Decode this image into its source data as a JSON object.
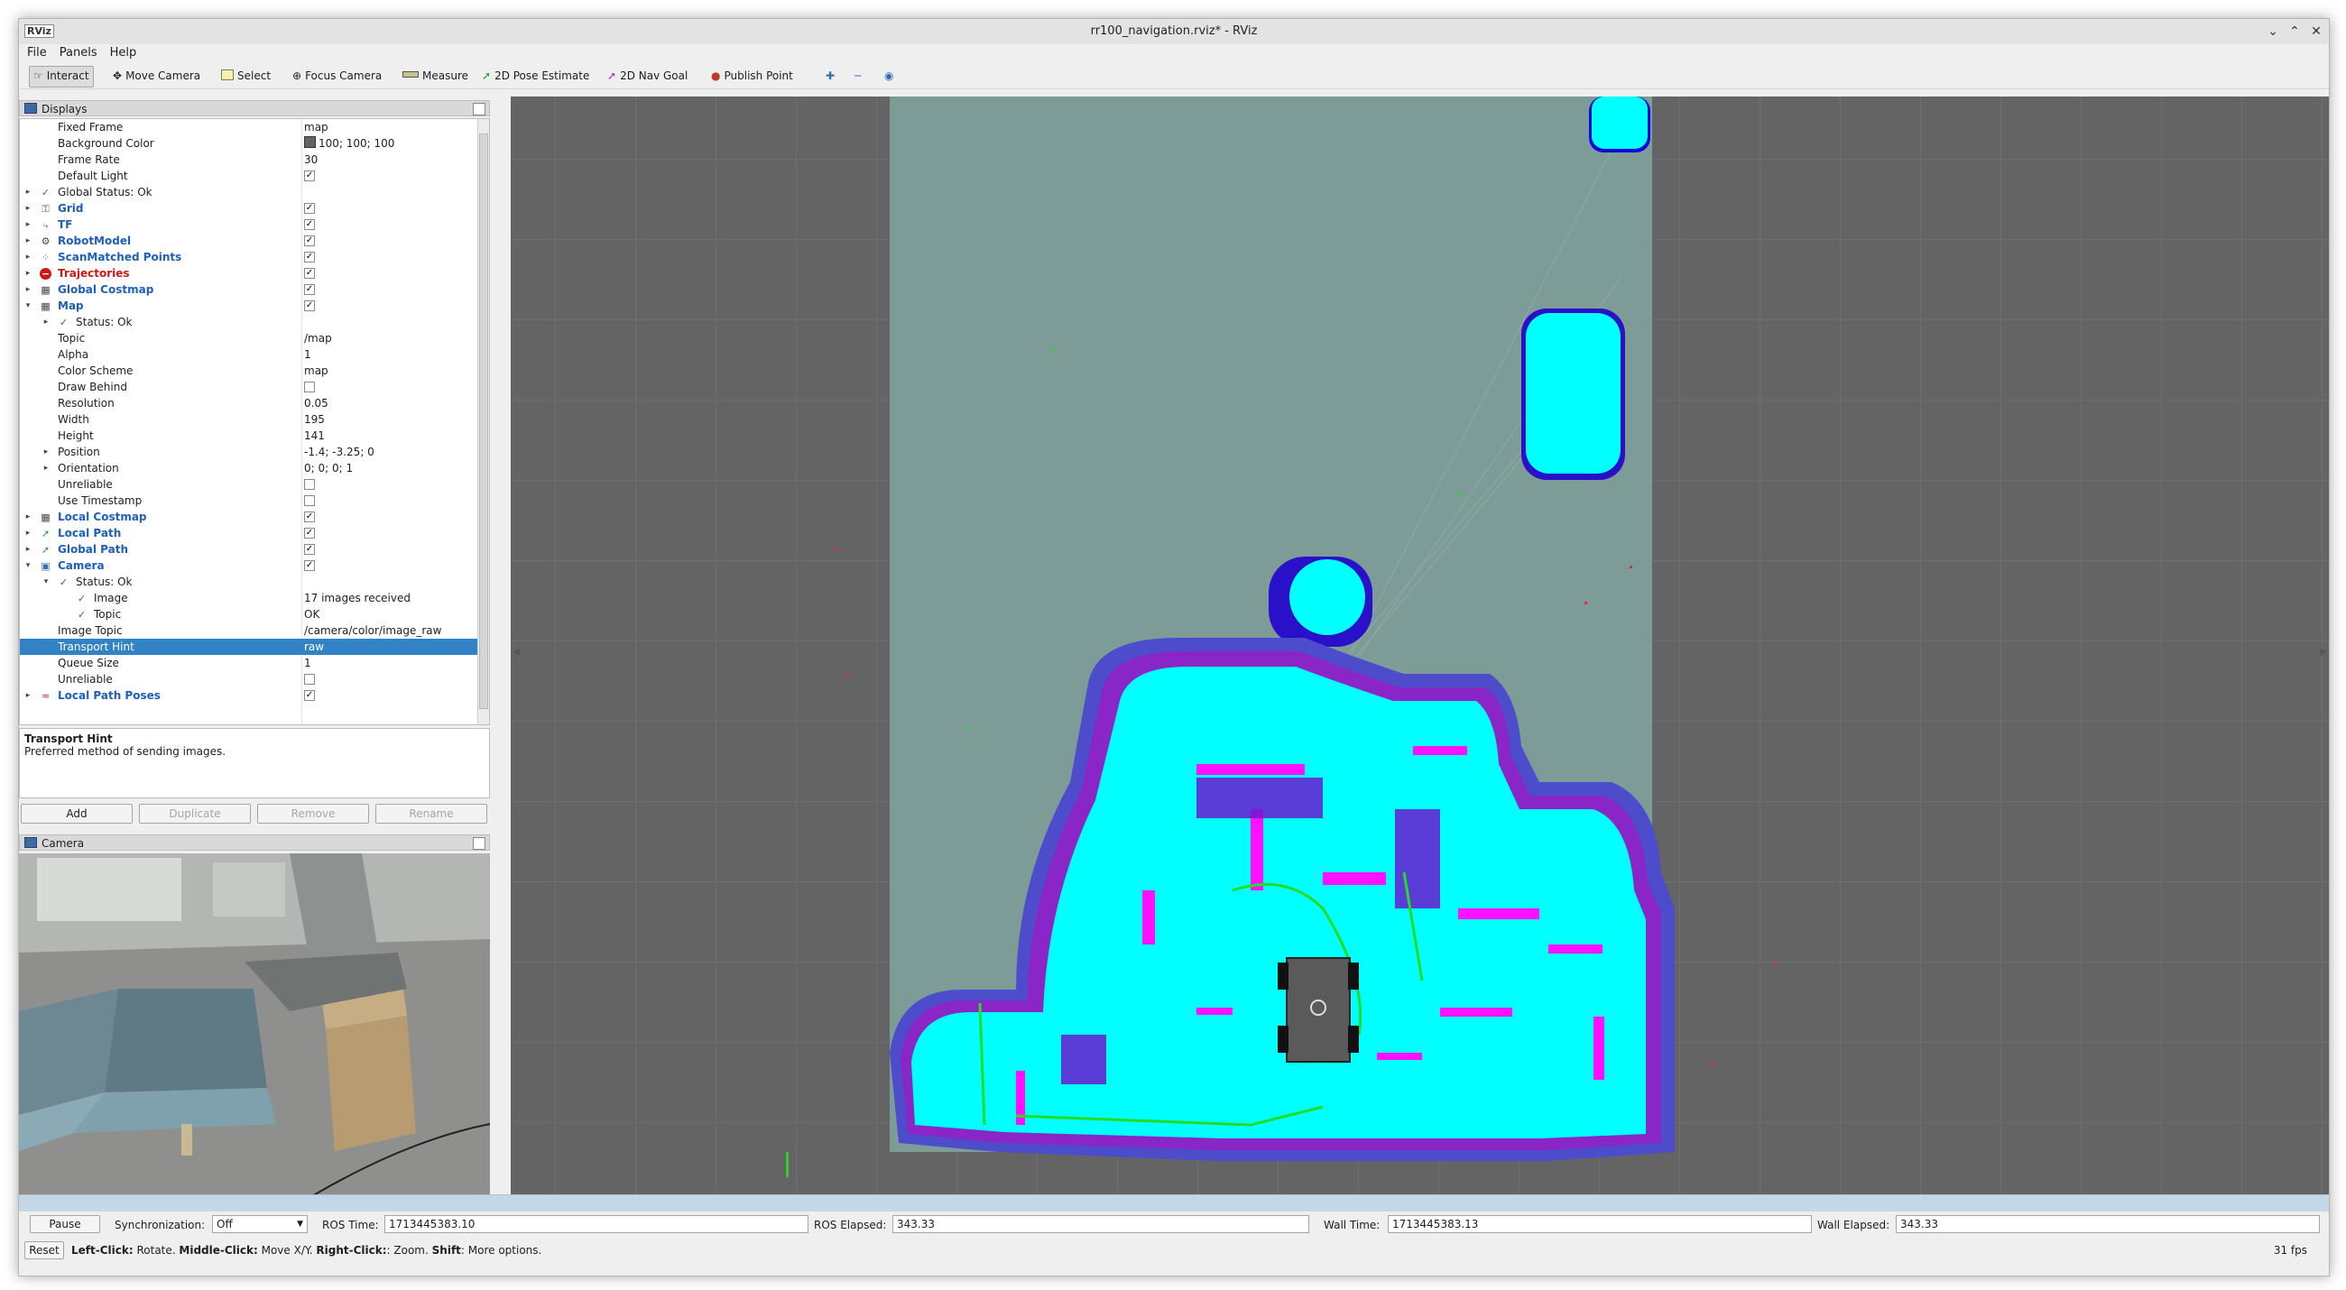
{
  "window": {
    "app_icon": "RViz",
    "title": "rr100_navigation.rviz* - RViz"
  },
  "menu": [
    "File",
    "Panels",
    "Help"
  ],
  "toolbar": {
    "tools": [
      {
        "label": "Interact",
        "icon": "hand-icon"
      },
      {
        "label": "Move Camera",
        "icon": "move-camera-icon"
      },
      {
        "label": "Select",
        "icon": "select-icon"
      },
      {
        "label": "Focus Camera",
        "icon": "focus-camera-icon"
      },
      {
        "label": "Measure",
        "icon": "ruler-icon"
      },
      {
        "label": "2D Pose Estimate",
        "icon": "pose-estimate-arrow-icon"
      },
      {
        "label": "2D Nav Goal",
        "icon": "nav-goal-arrow-icon"
      },
      {
        "label": "Publish Point",
        "icon": "pin-icon"
      }
    ],
    "extra_icons": [
      "add-tool-icon",
      "remove-tool-icon",
      "tool-properties-icon"
    ]
  },
  "displays_panel": {
    "title": "Displays",
    "rows": [
      {
        "name": "Fixed Frame",
        "value": "map"
      },
      {
        "name": "Background Color",
        "value": "100; 100; 100",
        "swatch": "#646464"
      },
      {
        "name": "Frame Rate",
        "value": "30"
      },
      {
        "name": "Default Light",
        "checked": true
      },
      {
        "name": "Global Status: Ok"
      },
      {
        "name": "Grid",
        "checked": true
      },
      {
        "name": "TF",
        "checked": true
      },
      {
        "name": "RobotModel",
        "checked": true
      },
      {
        "name": "ScanMatched Points",
        "checked": true
      },
      {
        "name": "Trajectories",
        "checked": true
      },
      {
        "name": "Global Costmap",
        "checked": true
      },
      {
        "name": "Map",
        "checked": true
      },
      {
        "name": "Status: Ok"
      },
      {
        "name": "Topic",
        "value": "/map"
      },
      {
        "name": "Alpha",
        "value": "1"
      },
      {
        "name": "Color Scheme",
        "value": "map"
      },
      {
        "name": "Draw Behind",
        "checked": false
      },
      {
        "name": "Resolution",
        "value": "0.05"
      },
      {
        "name": "Width",
        "value": "195"
      },
      {
        "name": "Height",
        "value": "141"
      },
      {
        "name": "Position",
        "value": "-1.4; -3.25; 0"
      },
      {
        "name": "Orientation",
        "value": "0; 0; 0; 1"
      },
      {
        "name": "Unreliable",
        "checked": false
      },
      {
        "name": "Use Timestamp",
        "checked": false
      },
      {
        "name": "Local Costmap",
        "checked": true
      },
      {
        "name": "Local Path",
        "checked": true
      },
      {
        "name": "Global Path",
        "checked": true
      },
      {
        "name": "Camera",
        "checked": true
      },
      {
        "name": "Status: Ok"
      },
      {
        "name": "Image",
        "value": "17 images received"
      },
      {
        "name": "Topic",
        "value": "OK"
      },
      {
        "name": "Image Topic",
        "value": "/camera/color/image_raw"
      },
      {
        "name": "Transport Hint",
        "value": "raw"
      },
      {
        "name": "Queue Size",
        "value": "1"
      },
      {
        "name": "Unreliable",
        "checked": false
      },
      {
        "name": "Local Path Poses",
        "checked": true
      }
    ],
    "description": {
      "title": "Transport Hint",
      "text": "Preferred method of sending images."
    },
    "buttons": [
      {
        "label": "Add",
        "enabled": true
      },
      {
        "label": "Duplicate",
        "enabled": false
      },
      {
        "label": "Remove",
        "enabled": false
      },
      {
        "label": "Rename",
        "enabled": false
      }
    ]
  },
  "camera_panel": {
    "title": "Camera"
  },
  "time_panel": {
    "pause_label": "Pause",
    "sync_label": "Synchronization:",
    "sync_value": "Off",
    "ros_time_label": "ROS Time:",
    "ros_time": "1713445383.10",
    "ros_elapsed_label": "ROS Elapsed:",
    "ros_elapsed": "343.33",
    "wall_time_label": "Wall Time:",
    "wall_time": "1713445383.13",
    "wall_elapsed_label": "Wall Elapsed:",
    "wall_elapsed": "343.33"
  },
  "status_bar": {
    "reset_label": "Reset",
    "hint_parts": [
      {
        "text": "Left-Click:",
        "bold": true
      },
      {
        "text": " Rotate. ",
        "bold": false
      },
      {
        "text": "Middle-Click:",
        "bold": true
      },
      {
        "text": " Move X/Y. ",
        "bold": false
      },
      {
        "text": "Right-Click:",
        "bold": true
      },
      {
        "text": ": Zoom. ",
        "bold": false
      },
      {
        "text": "Shift",
        "bold": true
      },
      {
        "text": ": More options.",
        "bold": false
      }
    ],
    "fps": "31 fps"
  },
  "colors": {
    "viewport_background": "#646464",
    "costmap_cyan": "#00ffff",
    "costmap_lethal": "#ff00ff",
    "costmap_inflation": "#3010d0",
    "selection": "#3282c8"
  }
}
